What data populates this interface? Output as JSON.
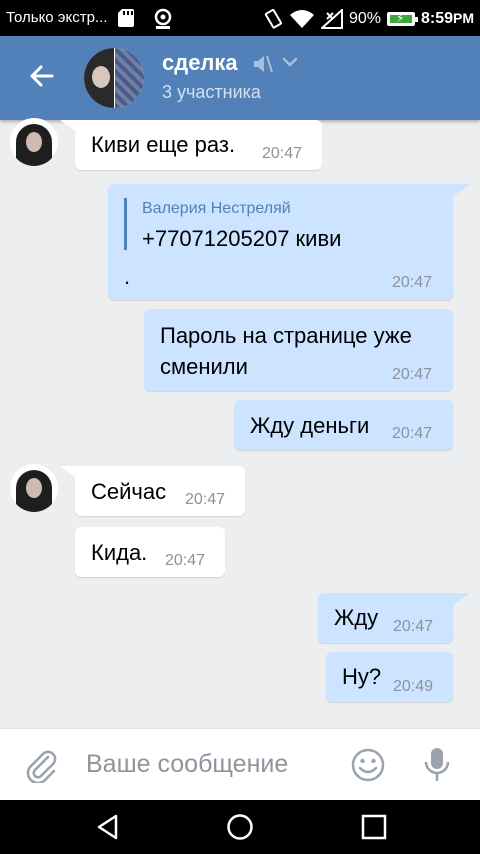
{
  "status_bar": {
    "notification_text": "Только экстр...",
    "battery_percent": "90%",
    "time": "8:59",
    "time_suffix": "PM",
    "battery_level": 0.9,
    "icons": [
      "sd-card-icon",
      "location-icon",
      "vibrate-icon",
      "wifi-icon",
      "signal-icon",
      "battery-charging-icon"
    ]
  },
  "header": {
    "title": "сделка",
    "subtitle": "3 участника",
    "icons": [
      "back-arrow-icon",
      "mute-icon",
      "chevron-down-icon"
    ],
    "color": "#5181b8"
  },
  "messages": [
    {
      "direction": "incoming",
      "text": "Киви еще раз.",
      "time": "20:47"
    },
    {
      "direction": "outgoing",
      "forwarded_from": "Валерия Нестреляй",
      "forwarded_text": "+77071205207 киви",
      "text": ".",
      "time": "20:47"
    },
    {
      "direction": "outgoing",
      "text_line1": "Пароль на странице уже",
      "text_line2": "сменили",
      "time": "20:47"
    },
    {
      "direction": "outgoing",
      "text": "Жду деньги",
      "time": "20:47"
    },
    {
      "direction": "incoming",
      "text": "Сейчас",
      "time": "20:47"
    },
    {
      "direction": "incoming",
      "text": "Кида.",
      "time": "20:47"
    },
    {
      "direction": "outgoing",
      "text": "Жду",
      "time": "20:47"
    },
    {
      "direction": "outgoing",
      "text": "Ну?",
      "time": "20:49"
    }
  ],
  "input": {
    "placeholder": "Ваше сообщение",
    "icons": [
      "attach-icon",
      "emoji-icon",
      "microphone-icon"
    ]
  },
  "nav_bar": {
    "icons": [
      "back-triangle-icon",
      "home-circle-icon",
      "recents-square-icon"
    ]
  },
  "colors": {
    "outgoing_bubble": "#cce4ff",
    "incoming_bubble": "#ffffff",
    "background": "#edeef0",
    "accent": "#5181b8"
  }
}
